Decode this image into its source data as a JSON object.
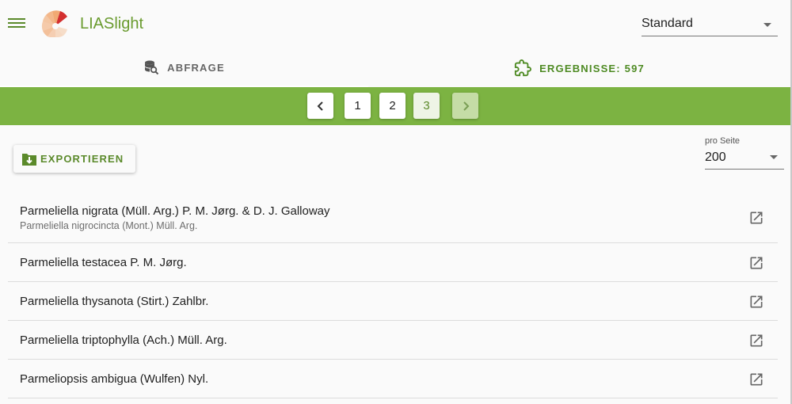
{
  "app": {
    "title": "LIASlight"
  },
  "header": {
    "menu_icon": "hamburger-menu-icon",
    "logo_icon": "lias-sunburst-logo",
    "standard_select": "Standard"
  },
  "tabs": [
    {
      "label": "ABFRAGE",
      "icon": "database-search-icon",
      "active": false
    },
    {
      "label": "ERGEBNISSE: 597",
      "icon": "puzzle-icon",
      "active": true
    }
  ],
  "pagination": {
    "pages": [
      "1",
      "2",
      "3"
    ],
    "current": "3",
    "prev_icon": "chevron-left-icon",
    "next_icon": "chevron-right-icon"
  },
  "toolbar": {
    "export_label": "EXPORTIEREN",
    "export_icon": "folder-download-icon",
    "per_page_label": "pro Seite",
    "per_page_value": "200"
  },
  "results": [
    {
      "name": "Parmeliella nigrata (Müll. Arg.) P. M. Jørg. & D. J. Galloway",
      "synonym": "Parmeliella nigrocincta (Mont.) Müll. Arg."
    },
    {
      "name": "Parmeliella testacea P. M. Jørg.",
      "synonym": ""
    },
    {
      "name": "Parmeliella thysanota (Stirt.) Zahlbr.",
      "synonym": ""
    },
    {
      "name": "Parmeliella triptophylla (Ach.) Müll. Arg.",
      "synonym": ""
    },
    {
      "name": "Parmeliopsis ambigua (Wulfen) Nyl.",
      "synonym": ""
    }
  ],
  "colors": {
    "brand_green": "#7cb342",
    "text_green": "#5b8a2b",
    "logo_orange": "#e8823a",
    "logo_red": "#d32f2f"
  }
}
